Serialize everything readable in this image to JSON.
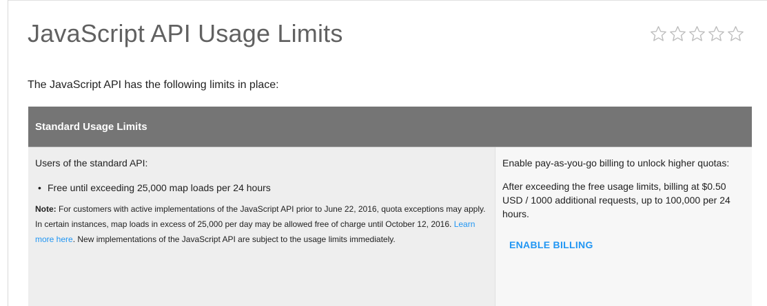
{
  "page": {
    "title": "JavaScript API Usage Limits",
    "rating": {
      "stars": 5,
      "value": 0,
      "star_color": "#bdbdbd"
    },
    "intro": "The JavaScript API has the following limits in place:"
  },
  "table": {
    "header": "Standard Usage Limits",
    "header_color": "#757575",
    "left": {
      "users_label": "Users of the standard API:",
      "bullets": [
        "Free until exceeding 25,000 map loads per 24 hours"
      ],
      "note": {
        "label": "Note:",
        "text_before_link": " For customers with active implementations of the JavaScript API prior to June 22, 2016, quota exceptions may apply. In certain instances, map loads in excess of 25,000 per day may be allowed free of charge until October 12, 2016. ",
        "link_text": "Learn more here",
        "text_after_link": ". New implementations of the JavaScript API are subject to the usage limits immediately."
      }
    },
    "right": {
      "paragraph_1": "Enable pay-as-you-go billing to unlock higher quotas:",
      "paragraph_2": "After exceeding the free usage limits, billing at $0.50 USD / 1000 additional requests, up to 100,000 per 24 hours.",
      "button_label": "ENABLE BILLING",
      "link_color": "#2196f3"
    }
  }
}
